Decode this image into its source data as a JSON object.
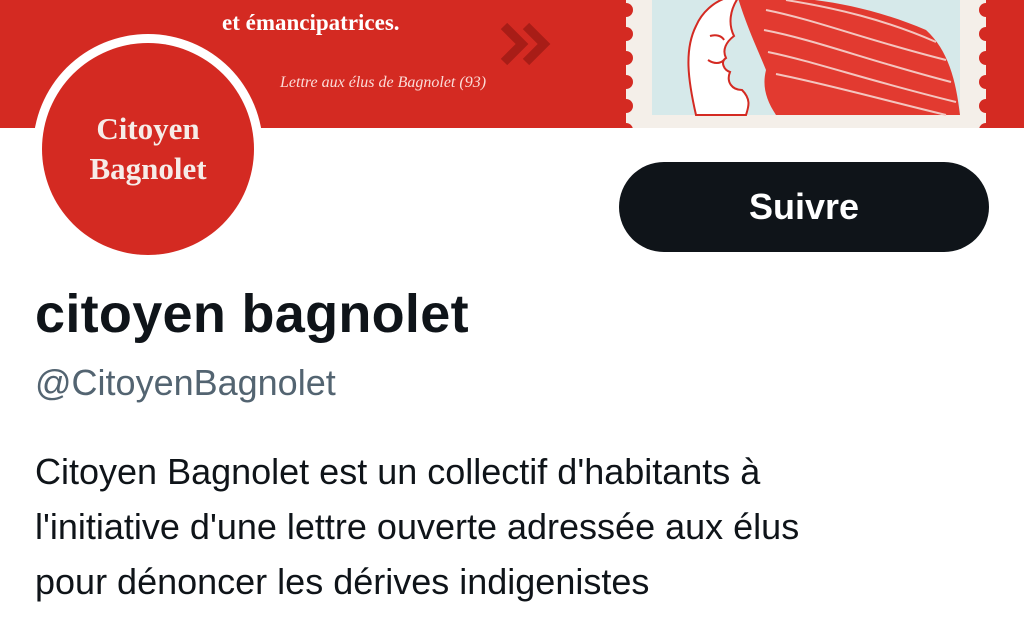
{
  "banner": {
    "line1": "",
    "line2": "et émancipatrices.",
    "subtitle": "Lettre aux élus de Bagnolet (93)",
    "stamp_icon": "marianne-stamp-icon",
    "arrows_icon": "double-chevron-right-icon"
  },
  "avatar": {
    "line1": "Citoyen",
    "line2": "Bagnolet"
  },
  "follow_button": {
    "label": "Suivre"
  },
  "profile": {
    "display_name": "citoyen bagnolet",
    "handle": "@CitoyenBagnolet",
    "bio_lines": [
      "Citoyen Bagnolet est un collectif d'habitants à",
      "l'initiative d'une lettre ouverte adressée aux élus",
      "pour dénoncer les dérives indigenistes"
    ]
  },
  "colors": {
    "brand_red": "#d42a22",
    "button_dark": "#0f1419",
    "handle_gray": "#536471"
  }
}
